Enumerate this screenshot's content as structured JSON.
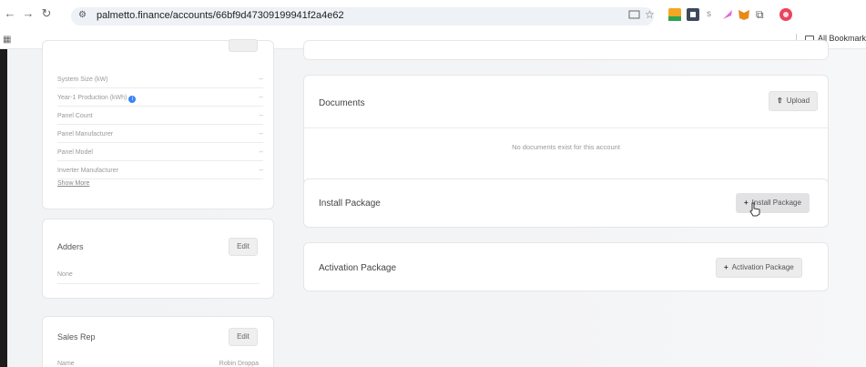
{
  "browser": {
    "url": "palmetto.finance/accounts/66bf9d47309199941f2a4e62",
    "bookmarks_label": "All Bookmarks"
  },
  "specs": {
    "rows": [
      {
        "label": "System Size (kW)",
        "value": "--"
      },
      {
        "label": "Year-1 Production (kWh)",
        "value": "--",
        "info": "i"
      },
      {
        "label": "Panel Count",
        "value": "--"
      },
      {
        "label": "Panel Manufacturer",
        "value": "--"
      },
      {
        "label": "Panel Model",
        "value": "--"
      },
      {
        "label": "Inverter Manufacturer",
        "value": "--"
      }
    ],
    "show_more": "Show More"
  },
  "adders": {
    "title": "Adders",
    "edit": "Edit",
    "value": "None"
  },
  "sales_rep": {
    "title": "Sales Rep",
    "edit": "Edit",
    "name_label": "Name",
    "name_value": "Robin Droppa"
  },
  "documents": {
    "title": "Documents",
    "upload": "Upload",
    "empty": "No documents exist for this account"
  },
  "install_package": {
    "title": "Install Package",
    "button": "Install Package"
  },
  "activation_package": {
    "title": "Activation Package",
    "button": "Activation Package"
  }
}
